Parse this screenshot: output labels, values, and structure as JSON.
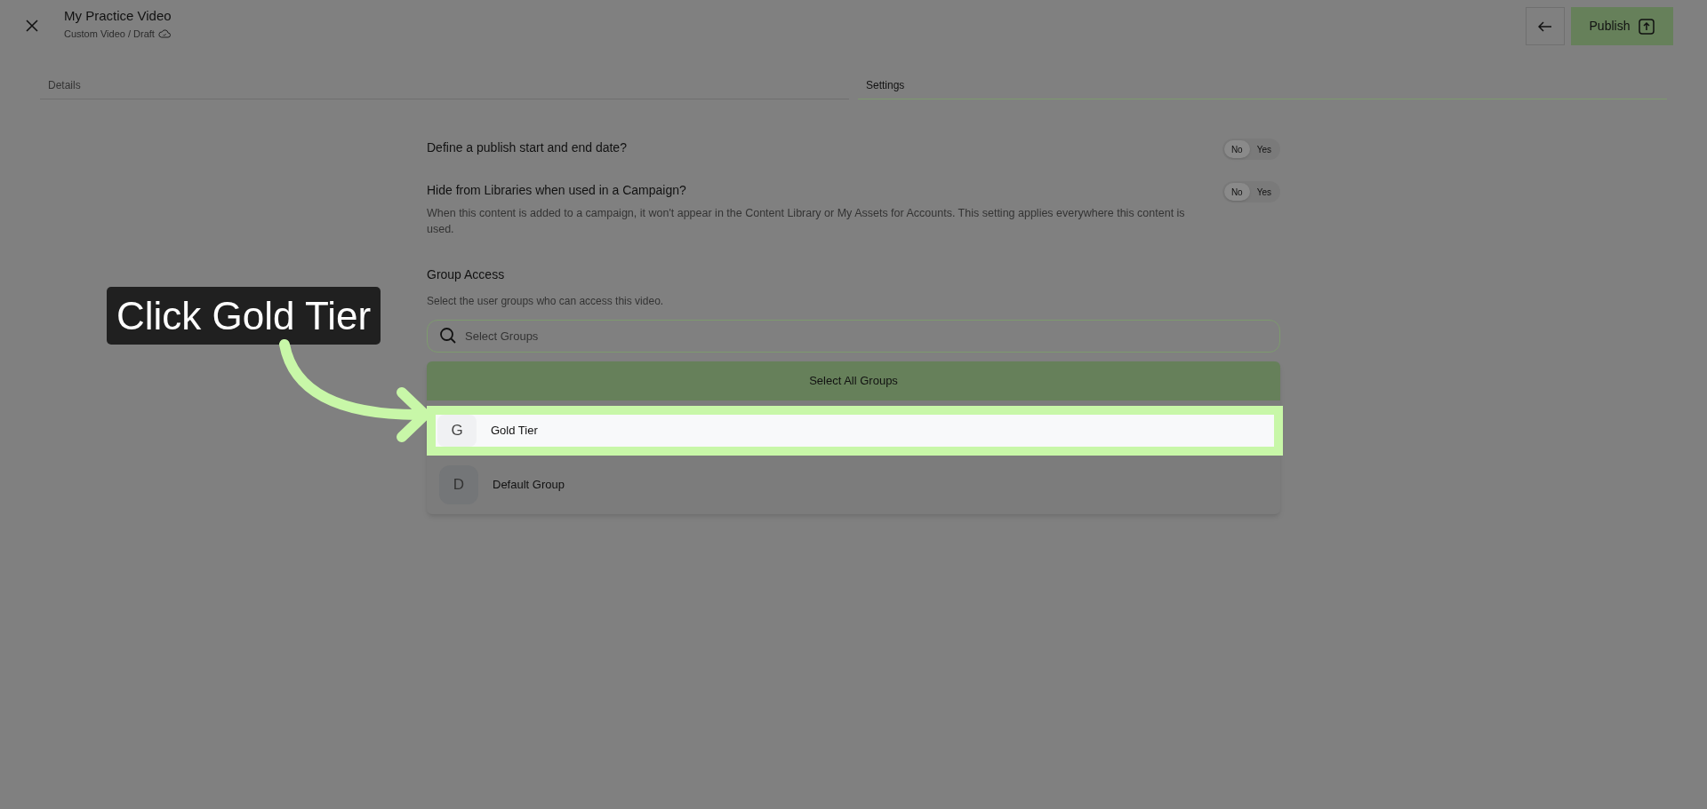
{
  "header": {
    "title": "My Practice Video",
    "subtitle": "Custom Video / Draft",
    "publish_label": "Publish"
  },
  "tabs": [
    {
      "label": "Details",
      "selected": false
    },
    {
      "label": "Settings",
      "selected": true
    }
  ],
  "settings": [
    {
      "question": "Define a publish start and end date?",
      "options": [
        {
          "label": "No",
          "selected": true
        },
        {
          "label": "Yes",
          "selected": false
        }
      ]
    },
    {
      "question": "Hide from Libraries when used in a Campaign?",
      "description": "When this content is added to a campaign, it won't appear in the Content Library or My Assets for Accounts. This setting applies everywhere this content is used.",
      "options": [
        {
          "label": "No",
          "selected": true
        },
        {
          "label": "Yes",
          "selected": false
        }
      ]
    }
  ],
  "group_access": {
    "title": "Group Access",
    "subtitle": "Select the user groups who can access this video.",
    "search": {
      "placeholder": "Select Groups"
    },
    "select_all_label": "Select All Groups",
    "groups": [
      {
        "initial": "G",
        "name": "Gold Tier",
        "highlighted": true
      },
      {
        "initial": "D",
        "name": "Default Group",
        "highlighted": false
      }
    ]
  },
  "callout": {
    "text": "Click Gold Tier"
  }
}
